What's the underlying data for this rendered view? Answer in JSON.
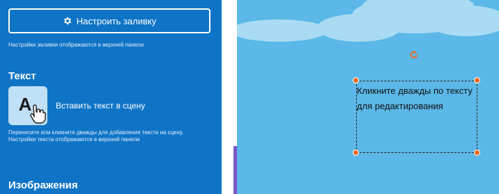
{
  "left_panel": {
    "fill_button_label": "Настроить заливку",
    "fill_hint": "Настройки заливки отображаются в верхней панели",
    "text_heading": "Текст",
    "insert_text_label": "Вставить текст в сцену",
    "insert_text_glyph": "A",
    "text_hint": "Перенесите или кликните дважды для добавления текста на сцену. Настройки текста отображаются в верхней панели",
    "images_heading": "Изображения"
  },
  "canvas": {
    "text_box_content": "Кликните дважды по тексту для редактирования"
  },
  "colors": {
    "panel_bg": "#0f74c6",
    "canvas_bg": "#5bb8e8",
    "handle": "#f26b1d"
  }
}
